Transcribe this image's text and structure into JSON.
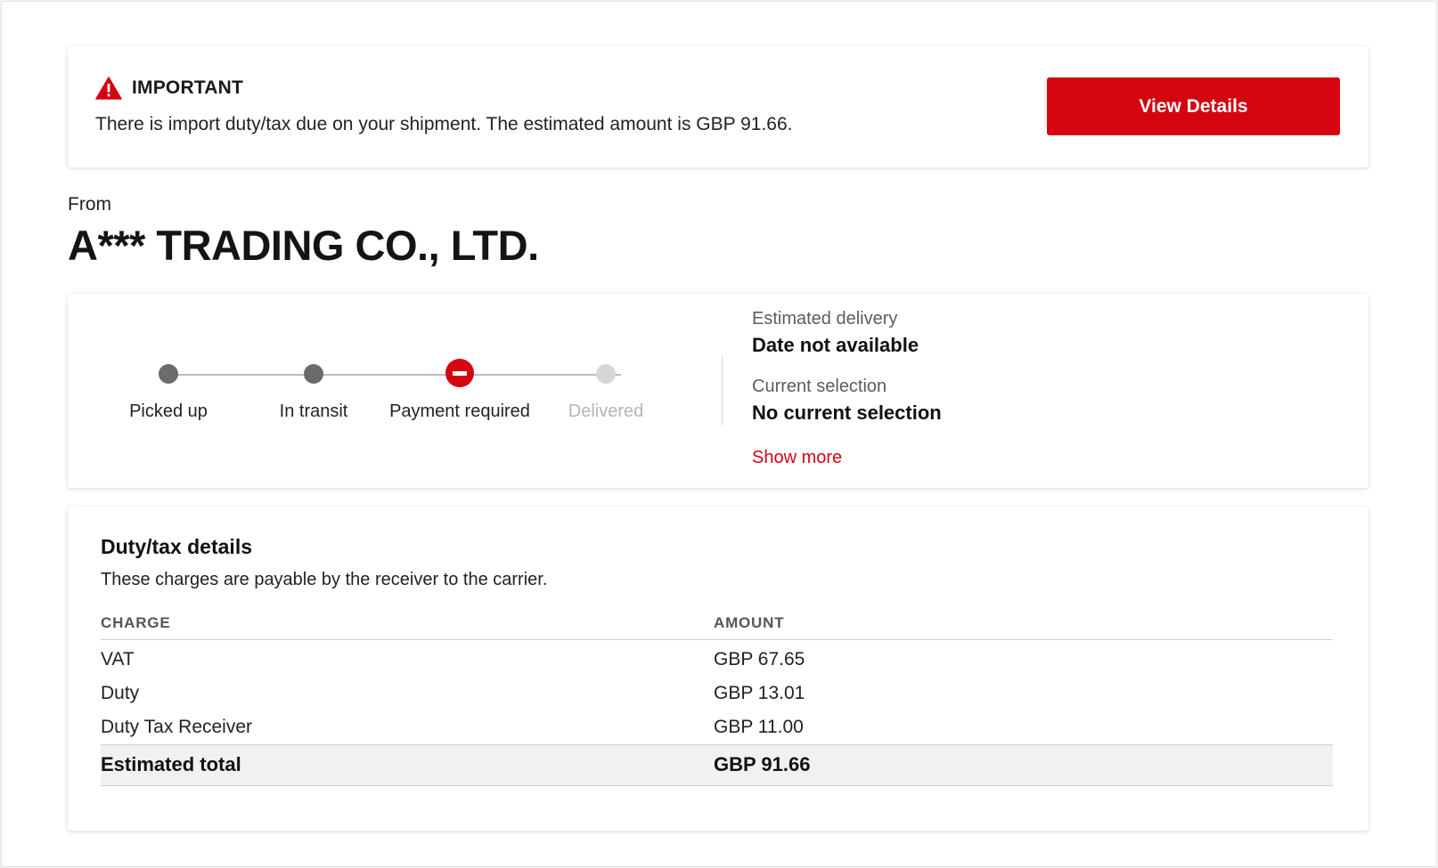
{
  "alert": {
    "title": "IMPORTANT",
    "message": "There is import duty/tax due on your shipment. The estimated amount is GBP 91.66.",
    "button_label": "View Details",
    "icon": "warning-triangle-icon"
  },
  "sender": {
    "from_label": "From",
    "name": "A*** TRADING CO., LTD."
  },
  "progress": {
    "steps": [
      {
        "label": "Picked up",
        "state": "done"
      },
      {
        "label": "In transit",
        "state": "done"
      },
      {
        "label": "Payment required",
        "state": "current"
      },
      {
        "label": "Delivered",
        "state": "future"
      }
    ]
  },
  "delivery": {
    "estimated_label": "Estimated delivery",
    "estimated_value": "Date not available",
    "selection_label": "Current selection",
    "selection_value": "No current selection",
    "show_more": "Show more"
  },
  "duty": {
    "title": "Duty/tax details",
    "subtitle": "These charges are payable by the receiver to the carrier.",
    "columns": {
      "charge": "CHARGE",
      "amount": "AMOUNT"
    },
    "rows": [
      {
        "charge": "VAT",
        "amount": "GBP 67.65"
      },
      {
        "charge": "Duty",
        "amount": "GBP 13.01"
      },
      {
        "charge": "Duty Tax Receiver",
        "amount": "GBP 11.00"
      }
    ],
    "total": {
      "charge": "Estimated total",
      "amount": "GBP 91.66"
    }
  },
  "colors": {
    "accent": "#d40511",
    "step_done": "#6b6b6b",
    "step_future": "#d6d6d6"
  }
}
